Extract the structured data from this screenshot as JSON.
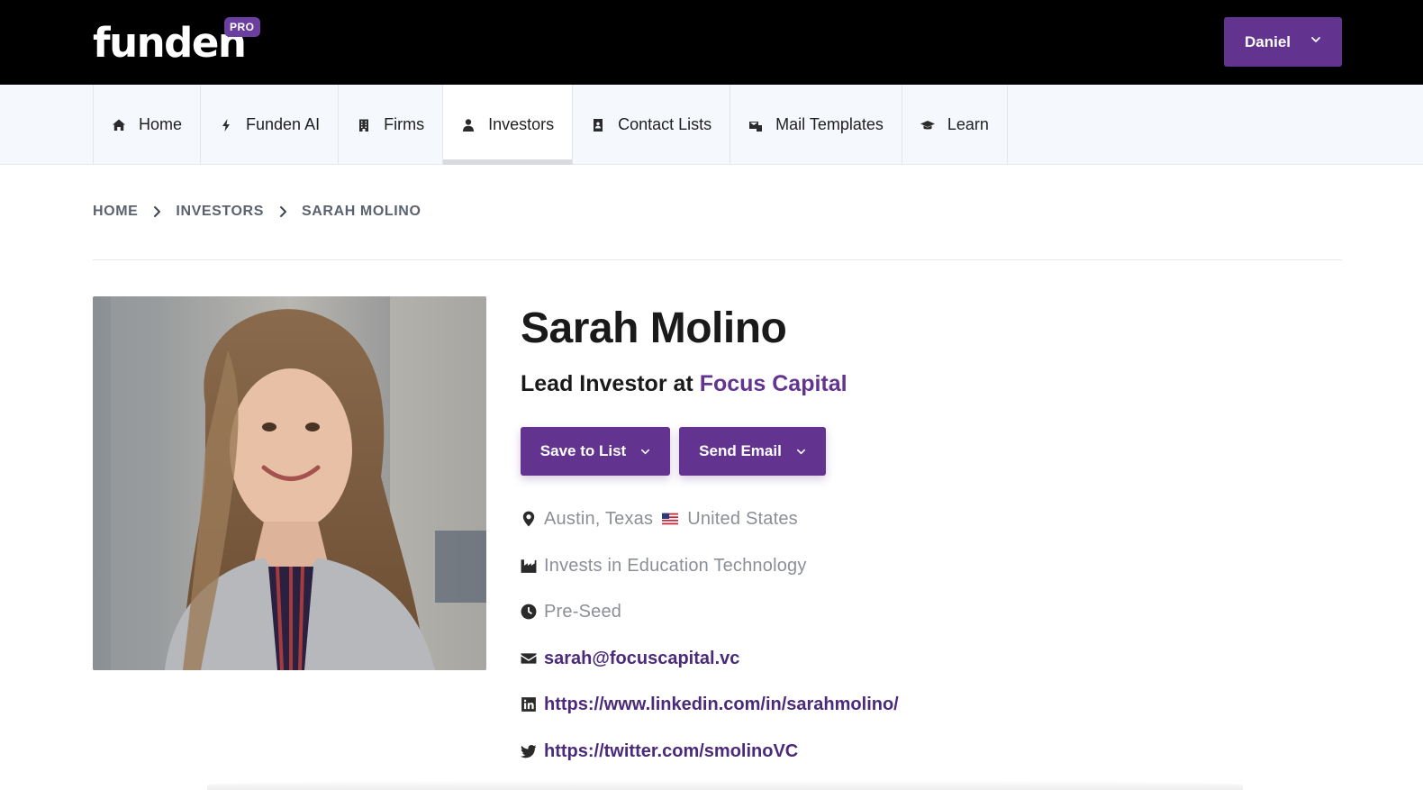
{
  "brand": {
    "logo": "funden",
    "badge": "PRO"
  },
  "user_menu": {
    "label": "Daniel"
  },
  "nav": {
    "items": [
      {
        "label": "Home",
        "icon": "home-icon"
      },
      {
        "label": "Funden AI",
        "icon": "bolt-icon"
      },
      {
        "label": "Firms",
        "icon": "building-icon"
      },
      {
        "label": "Investors",
        "icon": "user-icon",
        "active": true
      },
      {
        "label": "Contact Lists",
        "icon": "address-book-icon"
      },
      {
        "label": "Mail Templates",
        "icon": "mail-templates-icon"
      },
      {
        "label": "Learn",
        "icon": "graduation-cap-icon"
      }
    ]
  },
  "breadcrumb": {
    "home": "HOME",
    "investors": "INVESTORS",
    "current": "SARAH MOLINO"
  },
  "profile": {
    "name": "Sarah Molino",
    "title_prefix": "Lead Investor at",
    "firm": "Focus Capital",
    "location_city": "Austin, Texas",
    "location_country": "United States",
    "industry": "Invests in Education Technology",
    "stage": "Pre-Seed",
    "email": "sarah@focuscapital.vc",
    "linkedin": "https://www.linkedin.com/in/sarahmolino/",
    "twitter": "https://twitter.com/smolinoVC"
  },
  "actions": {
    "save_label": "Save to List",
    "email_label": "Send Email"
  },
  "colors": {
    "brand_purple": "#62348f",
    "topbar": "#000000",
    "nav_bg": "#f5f8fc"
  }
}
